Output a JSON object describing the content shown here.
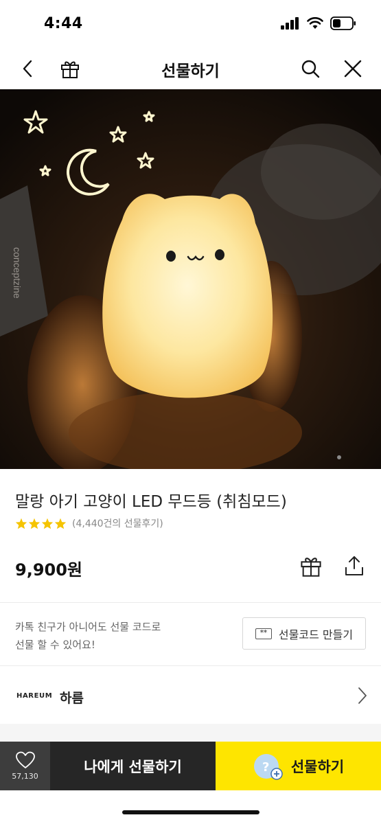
{
  "status": {
    "time": "4:44"
  },
  "nav": {
    "title": "선물하기"
  },
  "hero": {
    "image_text": "conceptzine"
  },
  "product": {
    "title": "말랑 아기 고양이 LED 무드등 (취침모드)",
    "rating_stars": 4,
    "review_text": "(4,440건의 선물후기)",
    "price": "9,900원"
  },
  "gift_code": {
    "text_line1": "카톡 친구가 아니어도 선물 코드로",
    "text_line2": "선물 할 수 있어요!",
    "button_label": "선물코드 만들기",
    "button_icon_text": "**"
  },
  "brand": {
    "logo_text": "HAREUM",
    "name": "하름"
  },
  "bottom": {
    "like_count": "57,130",
    "self_gift_label": "나에게 선물하기",
    "gift_label": "선물하기",
    "gift_icon_text": "?"
  },
  "colors": {
    "accent_yellow": "#fee500",
    "dark_button": "#262626",
    "like_box": "#3d3d3d",
    "star": "#f5c400"
  }
}
